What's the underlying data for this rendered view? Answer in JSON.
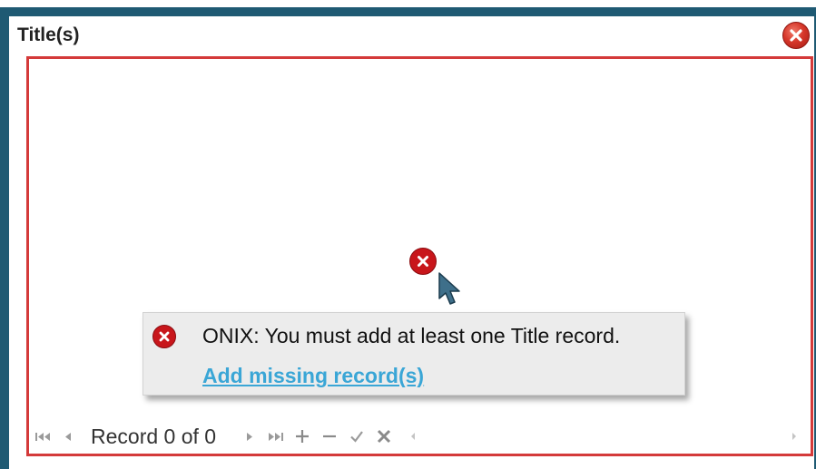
{
  "panel": {
    "title": "Title(s)",
    "close_icon": "close-icon"
  },
  "grid": {
    "status_icon": "error-circle-icon",
    "tooltip": {
      "icon": "error-circle-icon",
      "message": "ONIX: You must add at least one Title record.",
      "link": "Add missing record(s)"
    }
  },
  "pager": {
    "record_label": "Record 0 of 0",
    "buttons": [
      "first-page-icon",
      "prev-page-icon",
      "next-page-icon",
      "last-page-icon",
      "add-icon",
      "remove-icon",
      "confirm-icon",
      "cancel-icon",
      "scroll-left-icon",
      "scroll-right-icon"
    ]
  },
  "colors": {
    "frame": "#1f5a73",
    "error_border": "#d43a3a",
    "error_icon": "#c8161b",
    "link": "#3aa6d6",
    "tooltip_bg": "#ececec"
  }
}
